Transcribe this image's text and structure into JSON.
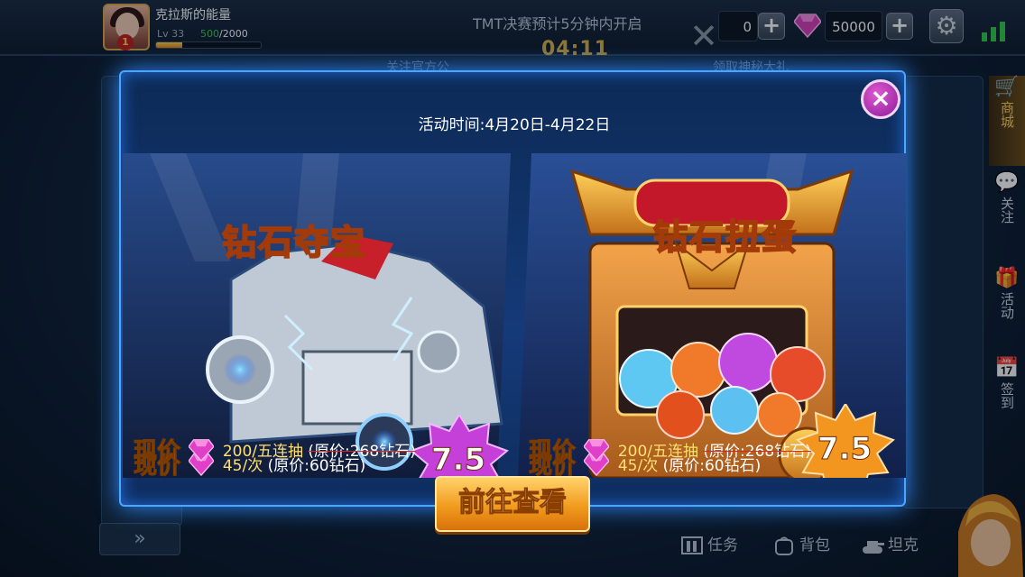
{
  "player": {
    "name": "克拉斯的能量",
    "level": "Lv 33",
    "exp_current": "500",
    "exp_sep": "/2000",
    "exp_progress": 0.25,
    "rank_badge": "1"
  },
  "header": {
    "notice": "TMT决赛预计5分钟内开启",
    "timer": "04:11"
  },
  "currency": {
    "coins_partial": "0",
    "gems": "50000",
    "plus": "+"
  },
  "behind": {
    "text_left": "关注官方公",
    "text_right": "领取神秘大礼"
  },
  "sidebar": {
    "items": [
      {
        "label": "商城",
        "icon": "shop-icon",
        "glyph": "🛒"
      },
      {
        "label": "关注",
        "icon": "chat-icon",
        "glyph": "💬"
      },
      {
        "label": "活动",
        "icon": "gift-icon",
        "glyph": "🎁"
      },
      {
        "label": "签到",
        "icon": "calendar-icon",
        "glyph": "📅"
      }
    ]
  },
  "bottombar": {
    "items": [
      {
        "label": "任务",
        "icon": "task-icon"
      },
      {
        "label": "背包",
        "icon": "backpack-icon"
      },
      {
        "label": "坦克",
        "icon": "tank-icon"
      }
    ],
    "expand": "»"
  },
  "modal": {
    "activity_time": "活动时间:4月20日-4月22日",
    "close": "×",
    "go_button": "前往查看",
    "cards": [
      {
        "title": "钻石夺宝",
        "discount": "7.5折",
        "rows": [
          {
            "now": "现价",
            "value": "45/次",
            "original": "(原价:60钻石)",
            "strike": false
          },
          {
            "now": "现价",
            "value": "200/五连抽",
            "original": "(原价:268钻石)",
            "strike": true
          }
        ]
      },
      {
        "title": "钻石扭蛋",
        "discount": "7.5折",
        "rows": [
          {
            "now": "现价",
            "value": "45/次",
            "original": "(原价:60钻石)",
            "strike": false
          },
          {
            "now": "现价",
            "value": "200/五连抽",
            "original": "(原价:268钻石)",
            "strike": true
          }
        ]
      }
    ]
  },
  "colors": {
    "accent": "#ffd24a",
    "modal_border": "#4aa6ff",
    "gem": "#e040c8",
    "close": "#a02aa8"
  }
}
